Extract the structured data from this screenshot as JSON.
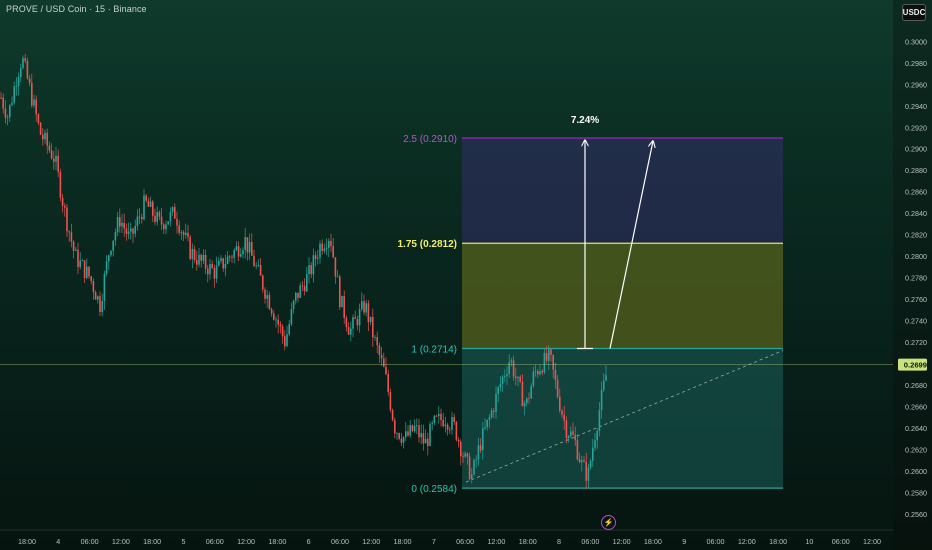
{
  "header": {
    "symbol_line": "PROVE / USD Coin · 15 · Binance",
    "currency_badge": "USDC"
  },
  "colors": {
    "up": "#26a69a",
    "down": "#ef5350",
    "fib_top": "#9c27b0",
    "fib_mid": "#e6e36a",
    "fib_base": "#26a69a",
    "price_line": "#c9e27a"
  },
  "icons": {
    "event": "lightning-icon"
  },
  "chart_data": {
    "type": "candlestick",
    "title": "PROVE / USD Coin · 15 · Binance",
    "ylim": [
      0.2545,
      0.3018
    ],
    "y_ticks": [
      "0.3000",
      "0.2980",
      "0.2960",
      "0.2940",
      "0.2920",
      "0.2900",
      "0.2880",
      "0.2860",
      "0.2840",
      "0.2820",
      "0.2800",
      "0.2780",
      "0.2760",
      "0.2740",
      "0.2720",
      "0.2700",
      "0.2680",
      "0.2660",
      "0.2640",
      "0.2620",
      "0.2600",
      "0.2580",
      "0.2560"
    ],
    "x_ticks": [
      "18:00",
      "4",
      "06:00",
      "12:00",
      "18:00",
      "5",
      "06:00",
      "12:00",
      "18:00",
      "6",
      "06:00",
      "12:00",
      "18:00",
      "7",
      "06:00",
      "12:00",
      "18:00",
      "8",
      "06:00",
      "12:00",
      "18:00",
      "9",
      "06:00",
      "12:00",
      "18:00",
      "10",
      "06:00",
      "12:00"
    ],
    "price_series": [
      {
        "x": 0,
        "y": 0.295
      },
      {
        "x": 8,
        "y": 0.293
      },
      {
        "x": 16,
        "y": 0.2965
      },
      {
        "x": 22,
        "y": 0.2985
      },
      {
        "x": 30,
        "y": 0.2955
      },
      {
        "x": 40,
        "y": 0.2915
      },
      {
        "x": 55,
        "y": 0.289
      },
      {
        "x": 65,
        "y": 0.284
      },
      {
        "x": 75,
        "y": 0.28
      },
      {
        "x": 90,
        "y": 0.278
      },
      {
        "x": 100,
        "y": 0.2755
      },
      {
        "x": 110,
        "y": 0.281
      },
      {
        "x": 120,
        "y": 0.2835
      },
      {
        "x": 130,
        "y": 0.2815
      },
      {
        "x": 145,
        "y": 0.285
      },
      {
        "x": 160,
        "y": 0.283
      },
      {
        "x": 175,
        "y": 0.284
      },
      {
        "x": 190,
        "y": 0.2805
      },
      {
        "x": 200,
        "y": 0.2795
      },
      {
        "x": 215,
        "y": 0.2785
      },
      {
        "x": 230,
        "y": 0.28
      },
      {
        "x": 245,
        "y": 0.2815
      },
      {
        "x": 260,
        "y": 0.278
      },
      {
        "x": 275,
        "y": 0.2745
      },
      {
        "x": 285,
        "y": 0.272
      },
      {
        "x": 295,
        "y": 0.276
      },
      {
        "x": 310,
        "y": 0.2785
      },
      {
        "x": 320,
        "y": 0.281
      },
      {
        "x": 330,
        "y": 0.282
      },
      {
        "x": 340,
        "y": 0.276
      },
      {
        "x": 350,
        "y": 0.273
      },
      {
        "x": 365,
        "y": 0.2755
      },
      {
        "x": 375,
        "y": 0.272
      },
      {
        "x": 385,
        "y": 0.269
      },
      {
        "x": 395,
        "y": 0.264
      },
      {
        "x": 405,
        "y": 0.263
      },
      {
        "x": 415,
        "y": 0.264
      },
      {
        "x": 425,
        "y": 0.2625
      },
      {
        "x": 435,
        "y": 0.2645
      },
      {
        "x": 445,
        "y": 0.265
      },
      {
        "x": 455,
        "y": 0.264
      },
      {
        "x": 465,
        "y": 0.261
      },
      {
        "x": 472,
        "y": 0.2595
      },
      {
        "x": 480,
        "y": 0.2625
      },
      {
        "x": 490,
        "y": 0.265
      },
      {
        "x": 500,
        "y": 0.268
      },
      {
        "x": 510,
        "y": 0.2705
      },
      {
        "x": 518,
        "y": 0.268
      },
      {
        "x": 526,
        "y": 0.266
      },
      {
        "x": 534,
        "y": 0.269
      },
      {
        "x": 542,
        "y": 0.27
      },
      {
        "x": 550,
        "y": 0.2705
      },
      {
        "x": 558,
        "y": 0.267
      },
      {
        "x": 566,
        "y": 0.264
      },
      {
        "x": 574,
        "y": 0.263
      },
      {
        "x": 582,
        "y": 0.2605
      },
      {
        "x": 588,
        "y": 0.2595
      },
      {
        "x": 594,
        "y": 0.263
      },
      {
        "x": 600,
        "y": 0.266
      },
      {
        "x": 608,
        "y": 0.2699
      }
    ],
    "fib_levels": [
      {
        "label": "2.5 (0.2910)",
        "value": 0.291
      },
      {
        "label": "1.75 (0.2812)",
        "value": 0.2812
      },
      {
        "label": "1 (0.2714)",
        "value": 0.2714
      },
      {
        "label": "0 (0.2584)",
        "value": 0.2584
      }
    ],
    "measure_label": "7.24%",
    "last_price": "0.2699",
    "last_price_value": 0.2699,
    "grid": false
  }
}
